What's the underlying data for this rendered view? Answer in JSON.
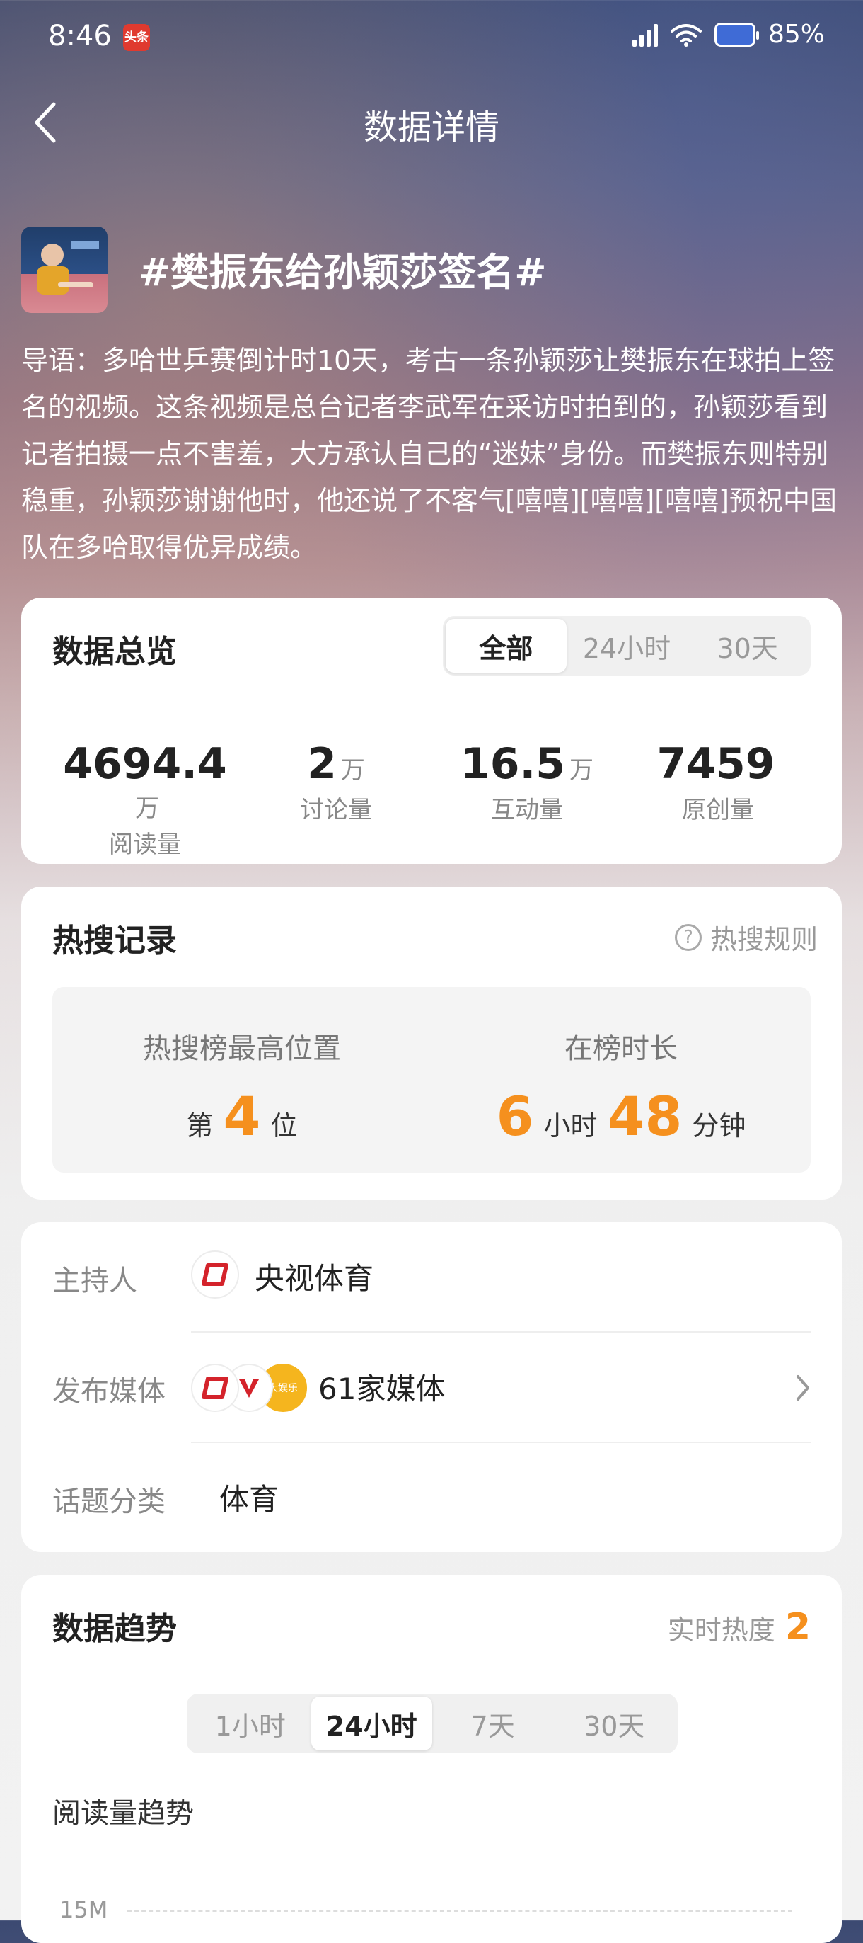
{
  "status_bar": {
    "time": "8:46",
    "news_badge": "头条",
    "battery": "85%"
  },
  "header": {
    "title": "数据详情"
  },
  "topic": {
    "title": "#樊振东给孙颖莎签名#",
    "intro": "导语：多哈世乒赛倒计时10天，考古一条孙颖莎让樊振东在球拍上签名的视频。这条视频是总台记者李武军在采访时拍到的，孙颖莎看到记者拍摄一点不害羞，大方承认自己的“迷妹”身份。而樊振东则特别稳重，孙颖莎谢谢他时，他还说了不客气[嘻嘻][嘻嘻][嘻嘻]预祝中国队在多哈取得优异成绩。"
  },
  "overview": {
    "title": "数据总览",
    "tabs": [
      {
        "label": "全部",
        "active": true
      },
      {
        "label": "24小时",
        "active": false
      },
      {
        "label": "30天",
        "active": false
      }
    ],
    "stats": [
      {
        "value": "4694.4",
        "unit": "万",
        "label": "阅读量"
      },
      {
        "value": "2",
        "unit": "万",
        "label": "讨论量"
      },
      {
        "value": "16.5",
        "unit": "万",
        "label": "互动量"
      },
      {
        "value": "7459",
        "unit": "",
        "label": "原创量"
      }
    ]
  },
  "hot_search": {
    "title": "热搜记录",
    "rules_label": "热搜规则",
    "peak_label": "热搜榜最高位置",
    "peak_prefix": "第",
    "peak_value": "4",
    "peak_suffix": "位",
    "duration_label": "在榜时长",
    "hours": "6",
    "hours_unit": "小时",
    "minutes": "48",
    "minutes_unit": "分钟"
  },
  "info": {
    "host_label": "主持人",
    "host_value": "央视体育",
    "media_label": "发布媒体",
    "media_value": "61家媒体",
    "media_logo_text": "大娱乐",
    "category_label": "话题分类",
    "category_value": "体育"
  },
  "trend": {
    "title": "数据趋势",
    "realtime_label": "实时热度",
    "realtime_value": "2",
    "tabs": [
      {
        "label": "1小时",
        "active": false
      },
      {
        "label": "24小时",
        "active": true
      },
      {
        "label": "7天",
        "active": false
      },
      {
        "label": "30天",
        "active": false
      }
    ],
    "chart_title": "阅读量趋势",
    "y_tick_top": "15M"
  },
  "colors": {
    "accent": "#f5901e",
    "brand_red": "#d4232b"
  }
}
